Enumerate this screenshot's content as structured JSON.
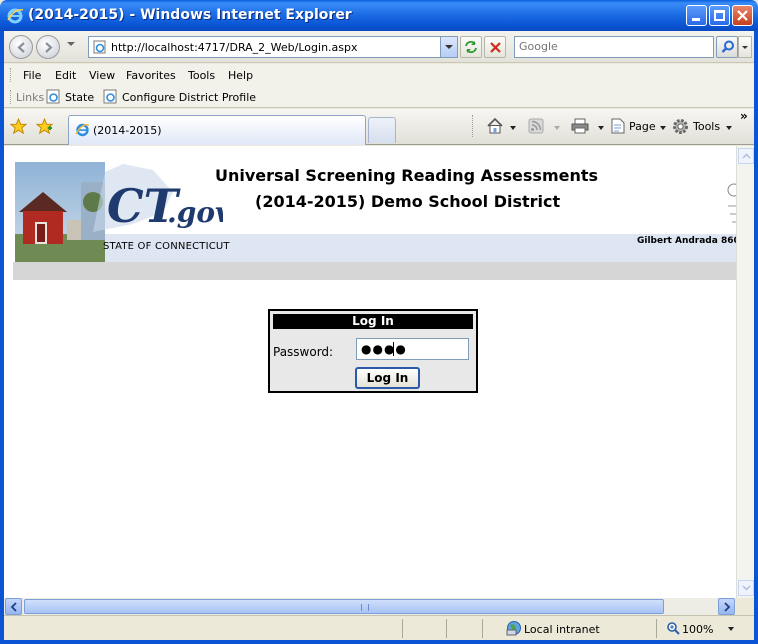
{
  "window": {
    "title": "(2014-2015) - Windows Internet Explorer"
  },
  "address_bar": {
    "url": "http://localhost:4717/DRA_2_Web/Login.aspx",
    "search_placeholder": "Google"
  },
  "menu": {
    "items": [
      "File",
      "Edit",
      "View",
      "Favorites",
      "Tools",
      "Help"
    ]
  },
  "links_bar": {
    "label": "Links",
    "links": [
      "State",
      "Configure District Profile"
    ]
  },
  "tabs": {
    "active_label": "(2014-2015)"
  },
  "command_bar": {
    "page_label": "Page",
    "tools_label": "Tools",
    "overflow": "»"
  },
  "banner": {
    "title_line1": "Universal Screening Reading Assessments",
    "title_line2": "(2014-2015) Demo School District",
    "state_label": "STATE OF CONNECTICUT",
    "logo_text": "CT.gov",
    "user_text": "Gilbert Andrada 860"
  },
  "login": {
    "header": "Log In",
    "password_label": "Password:",
    "password_masked": "●●●●",
    "button_label": "Log In"
  },
  "status_bar": {
    "zone": "Local intranet",
    "zoom": "100%"
  },
  "colors": {
    "titlebar": "#0b55d4",
    "login_header_bg": "#000000",
    "banner_strip": "#dde6f2"
  }
}
